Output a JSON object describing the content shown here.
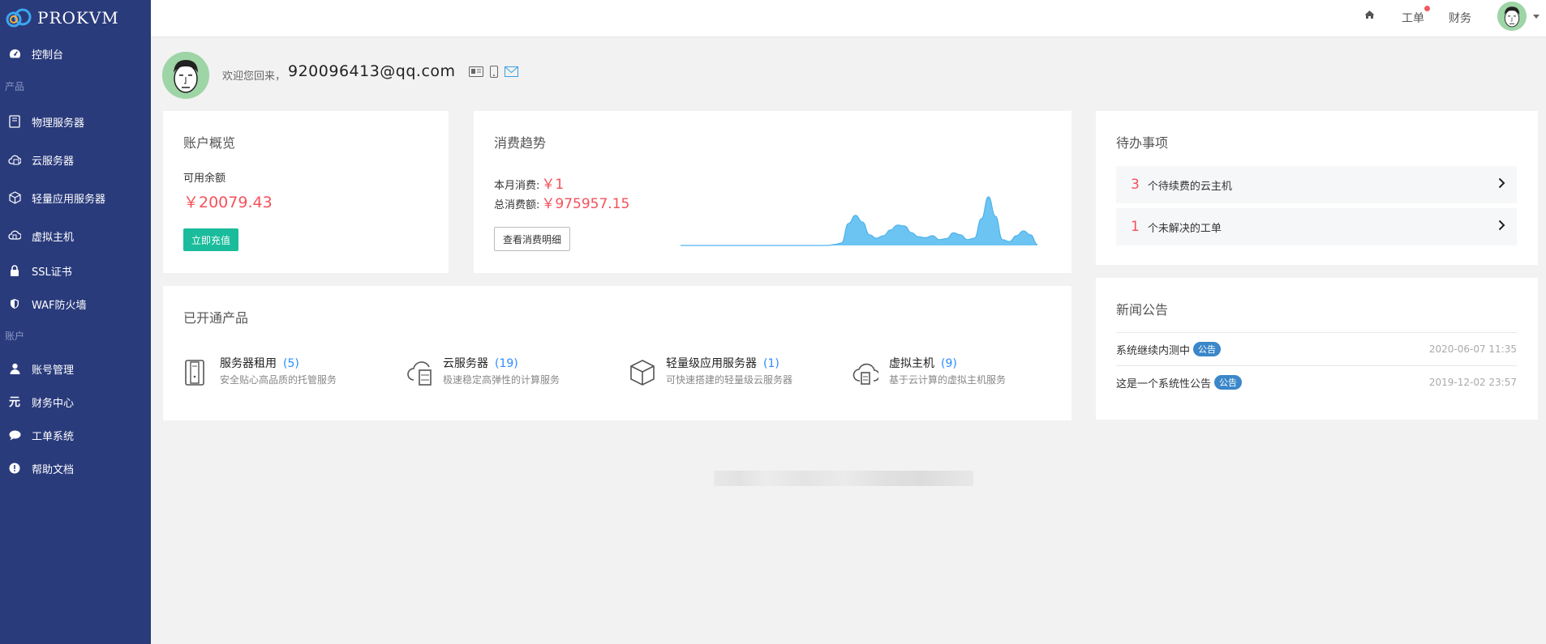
{
  "brand": {
    "name": "PROKVM"
  },
  "sidebar": {
    "dashboard": "控制台",
    "section_products": "产品",
    "products": [
      {
        "label": "物理服务器",
        "icon": "server-rack-icon"
      },
      {
        "label": "云服务器",
        "icon": "cloud-server-icon"
      },
      {
        "label": "轻量应用服务器",
        "icon": "cube-icon"
      },
      {
        "label": "虚拟主机",
        "icon": "cloud-host-icon"
      },
      {
        "label": "SSL证书",
        "icon": "lock-icon"
      },
      {
        "label": "WAF防火墙",
        "icon": "shield-icon"
      }
    ],
    "section_account": "账户",
    "account": [
      {
        "label": "账号管理",
        "icon": "user-icon"
      },
      {
        "label": "财务中心",
        "icon": "yuan-icon"
      },
      {
        "label": "工单系统",
        "icon": "chat-icon"
      },
      {
        "label": "帮助文档",
        "icon": "info-icon"
      }
    ]
  },
  "topbar": {
    "home_icon": "home-icon",
    "ticket": "工单",
    "finance": "财务"
  },
  "welcome": {
    "greeting": "欢迎您回来，",
    "email": "920096413@qq.com"
  },
  "account_overview": {
    "title": "账户概览",
    "balance_label": "可用余额",
    "balance": "￥20079.43",
    "recharge": "立即充值"
  },
  "trend": {
    "title": "消费趋势",
    "month_label": "本月消费:",
    "month_value": "￥1",
    "total_label": "总消费额:",
    "total_value": "￥975957.15",
    "detail_button": "查看消费明细"
  },
  "chart_data": {
    "type": "area",
    "title": "",
    "xlabel": "",
    "ylabel": "",
    "values": [
      0,
      0,
      0,
      0,
      0,
      0,
      0,
      0,
      0,
      0,
      0,
      0,
      0,
      0,
      0,
      0,
      0,
      0,
      0,
      0,
      0,
      0,
      0.02,
      0.05,
      0.45,
      0.62,
      0.48,
      0.22,
      0.15,
      0.2,
      0.32,
      0.42,
      0.4,
      0.26,
      0.18,
      0.16,
      0.2,
      0.12,
      0.14,
      0.26,
      0.22,
      0.12,
      0.15,
      0.55,
      1.0,
      0.6,
      0.12,
      0.08,
      0.2,
      0.3,
      0.22,
      0.02
    ],
    "grid": false,
    "color": "#6cc4f2"
  },
  "todo": {
    "title": "待办事项",
    "items": [
      {
        "count": "3",
        "label": "个待续费的云主机"
      },
      {
        "count": "1",
        "label": "个未解决的工单"
      }
    ]
  },
  "opened_products": {
    "title": "已开通产品",
    "items": [
      {
        "name": "服务器租用",
        "count": "(5)",
        "desc": "安全贴心高品质的托管服务",
        "icon": "server-rack-icon"
      },
      {
        "name": "云服务器",
        "count": "(19)",
        "desc": "极速稳定高弹性的计算服务",
        "icon": "cloud-server-icon"
      },
      {
        "name": "轻量级应用服务器",
        "count": "(1)",
        "desc": "可快速搭建的轻量级云服务器",
        "icon": "cube-icon"
      },
      {
        "name": "虚拟主机",
        "count": "(9)",
        "desc": "基于云计算的虚拟主机服务",
        "icon": "cloud-host-icon"
      }
    ]
  },
  "news": {
    "title": "新闻公告",
    "items": [
      {
        "title": "系统继续内测中",
        "badge": "公告",
        "date": "2020-06-07 11:35"
      },
      {
        "title": "这是一个系统性公告",
        "badge": "公告",
        "date": "2019-12-02 23:57"
      }
    ]
  },
  "colors": {
    "sidebar": "#2a3b7c",
    "accent_red": "#f4525a",
    "accent_green": "#1abc9c",
    "accent_blue": "#2a8cff"
  }
}
